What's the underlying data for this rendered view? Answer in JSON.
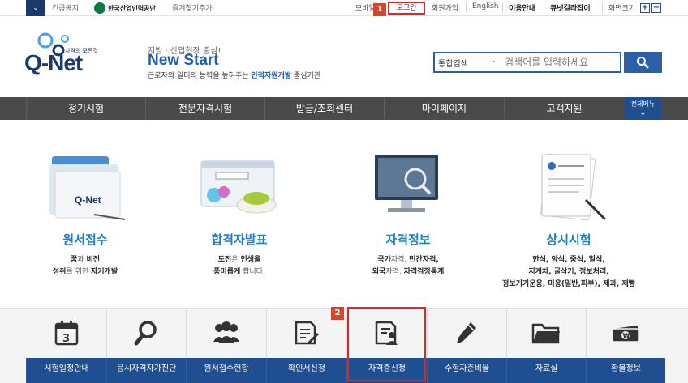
{
  "topbar": {
    "toggle": "⌄",
    "notice": "긴급공지",
    "org_name": "한국산업인력공단",
    "bookmark": "즐겨찾기추가",
    "mobile": "모바일",
    "login": "로그인",
    "signup": "회원가입",
    "english": "English",
    "usage": "이용안내",
    "guide": "큐넷길라잡이",
    "zoom_label": "화면크기",
    "zoom_in": "+",
    "zoom_out": "−"
  },
  "badges": {
    "first": "1",
    "second": "2"
  },
  "logo": {
    "sub": "자격의 모든것",
    "main": "Q-Net"
  },
  "slogan": {
    "small": "지방 · 산업현장 중심!",
    "big": "New Start",
    "desc_pre": "근로자와 일터의 능력을 높혀주는 ",
    "desc_hl": "인적자원개발",
    "desc_post": " 중심기관"
  },
  "search": {
    "scope": "통합검색",
    "placeholder": "검색어를 입력하세요",
    "button_icon": "search-icon"
  },
  "nav": {
    "items": [
      "정기시험",
      "전문자격시험",
      "발급/조회센터",
      "마이페이지",
      "고객지원"
    ],
    "all_menu": "전체메뉴"
  },
  "features": [
    {
      "title": "원서접수",
      "lines": [
        [
          "꿈",
          "과 ",
          "비전"
        ],
        [
          "성취",
          "를 위한 ",
          "자기개발"
        ]
      ]
    },
    {
      "title": "합격자발표",
      "lines": [
        [
          "도전",
          "은 ",
          "인생을"
        ],
        [
          "풍미롭게",
          " 합니다.",
          ""
        ]
      ]
    },
    {
      "title": "자격정보",
      "lines": [
        [
          "국가",
          "자격, ",
          "민간자격,"
        ],
        [
          "외국",
          "자격, ",
          "자격검정통계"
        ]
      ]
    },
    {
      "title": "상시시험",
      "lines": [
        [
          "한식, 양식, 중식, 일식,",
          "",
          ""
        ],
        [
          "지게차, 굴삭기, 정보처리,",
          "",
          ""
        ],
        [
          "정보기기운용, 미용(일반,피부), 제과, 제빵",
          "",
          ""
        ]
      ]
    }
  ],
  "feature_icons": [
    "folder-icon",
    "browser-window-icon",
    "monitor-magnifier-icon",
    "certificate-document-icon"
  ],
  "quick_menu": [
    {
      "label": "시험일정안내",
      "icon": "calendar-icon"
    },
    {
      "label": "응시자격자가진단",
      "icon": "magnifier-icon"
    },
    {
      "label": "원서접수현황",
      "icon": "people-icon"
    },
    {
      "label": "확인서신청",
      "icon": "form-pen-icon"
    },
    {
      "label": "자격증신청",
      "icon": "certificate-person-icon"
    },
    {
      "label": "수험자준비물",
      "icon": "pencil-icon"
    },
    {
      "label": "자료실",
      "icon": "folder-icon"
    },
    {
      "label": "환불정보",
      "icon": "money-icon"
    }
  ],
  "colors": {
    "brand_blue": "#1f4f91",
    "accent_blue": "#1c7fc6",
    "nav_gray": "#4a4a4a",
    "highlight_red": "#d42a2a"
  }
}
